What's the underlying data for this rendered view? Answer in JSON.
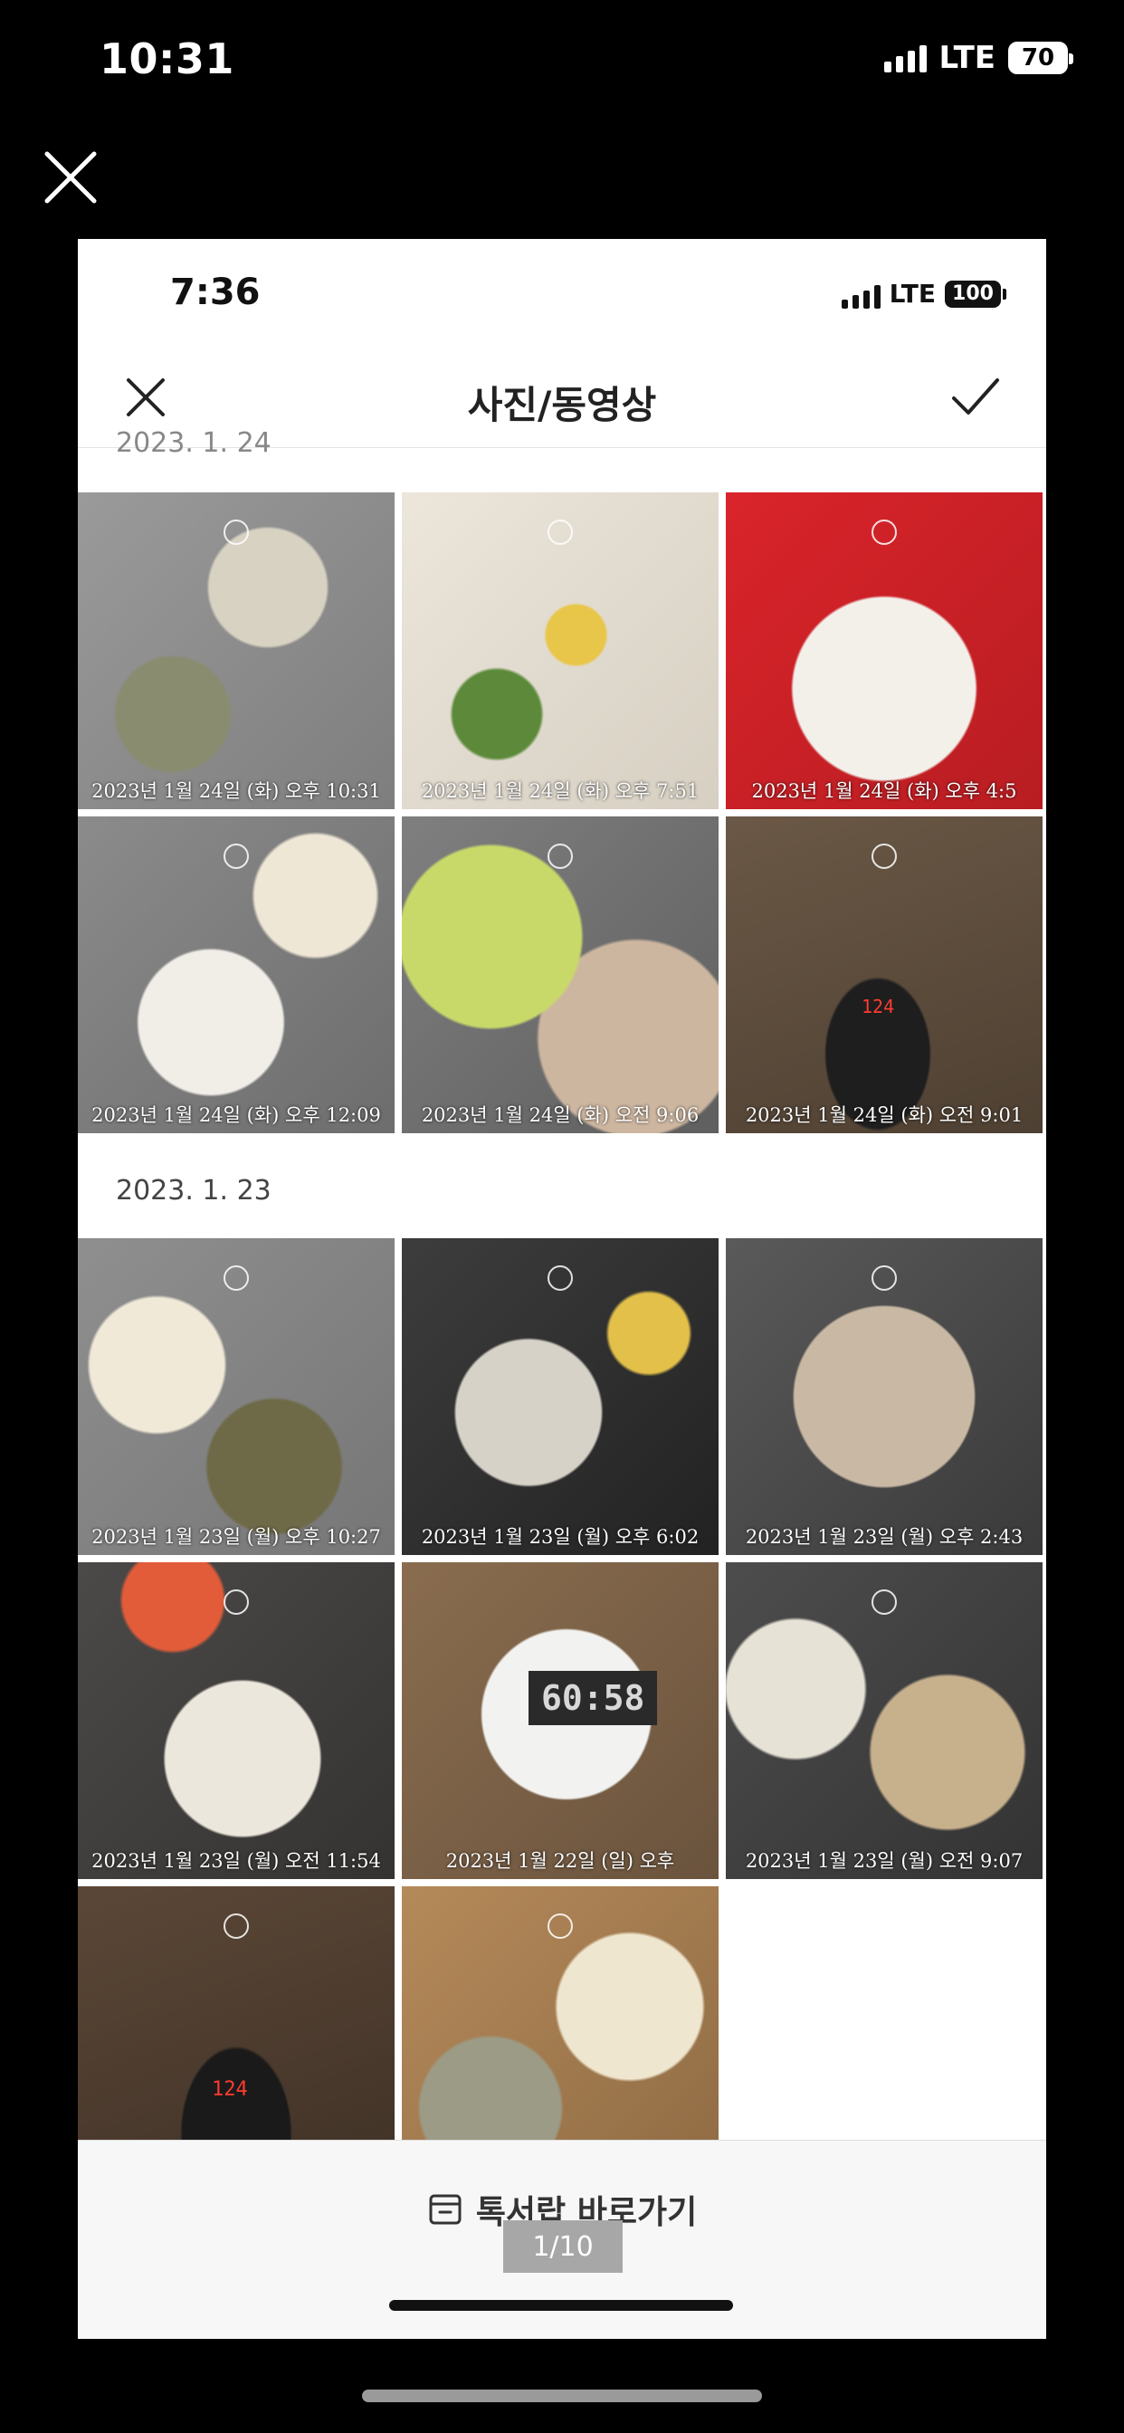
{
  "outer_status": {
    "time": "10:31",
    "network": "LTE",
    "battery": "70"
  },
  "inner_status": {
    "time": "7:36",
    "network": "LTE",
    "battery": "100"
  },
  "nav": {
    "title": "사진/동영상"
  },
  "sections": [
    {
      "date": "2023. 1. 24",
      "photos": [
        {
          "stamp": "2023년 1월 24일 (화) 오후 10:31",
          "subject": "food"
        },
        {
          "stamp": "2023년 1월 24일 (화) 오후 7:51",
          "subject": "food"
        },
        {
          "stamp": "2023년 1월 24일 (화) 오후 4:5",
          "subject": "food"
        },
        {
          "stamp": "2023년 1월 24일 (화) 오후 12:09",
          "subject": "food"
        },
        {
          "stamp": "2023년 1월 24일 (화) 오전 9:06",
          "subject": "food"
        },
        {
          "stamp": "2023년 1월 24일 (화) 오전 9:01",
          "subject": "scale",
          "scale_reading": "124"
        }
      ]
    },
    {
      "date": "2023. 1. 23",
      "photos": [
        {
          "stamp": "2023년 1월 23일 (월) 오후 10:27",
          "subject": "food"
        },
        {
          "stamp": "2023년 1월 23일 (월) 오후 6:02",
          "subject": "food"
        },
        {
          "stamp": "2023년 1월 23일 (월) 오후 2:43",
          "subject": "food"
        },
        {
          "stamp": "2023년 1월 23일 (월) 오전 11:54",
          "subject": "food"
        },
        {
          "stamp": "2023년 1월 22일 (일) 오후",
          "subject": "timer",
          "timer_reading": "60:58"
        },
        {
          "stamp": "2023년 1월 23일 (월) 오전 9:07",
          "subject": "food"
        },
        {
          "stamp": "",
          "subject": "scale",
          "scale_reading": "124"
        },
        {
          "stamp": "",
          "subject": "food"
        }
      ]
    }
  ],
  "bottom": {
    "link": "톡서랍 바로가기",
    "page": "1/10"
  },
  "colors": {
    "black": "#000000",
    "white": "#ffffff",
    "page_indicator": "#a7a7a7"
  },
  "icons": [
    "close-icon",
    "check-icon",
    "drawer-icon",
    "clock-icon"
  ]
}
